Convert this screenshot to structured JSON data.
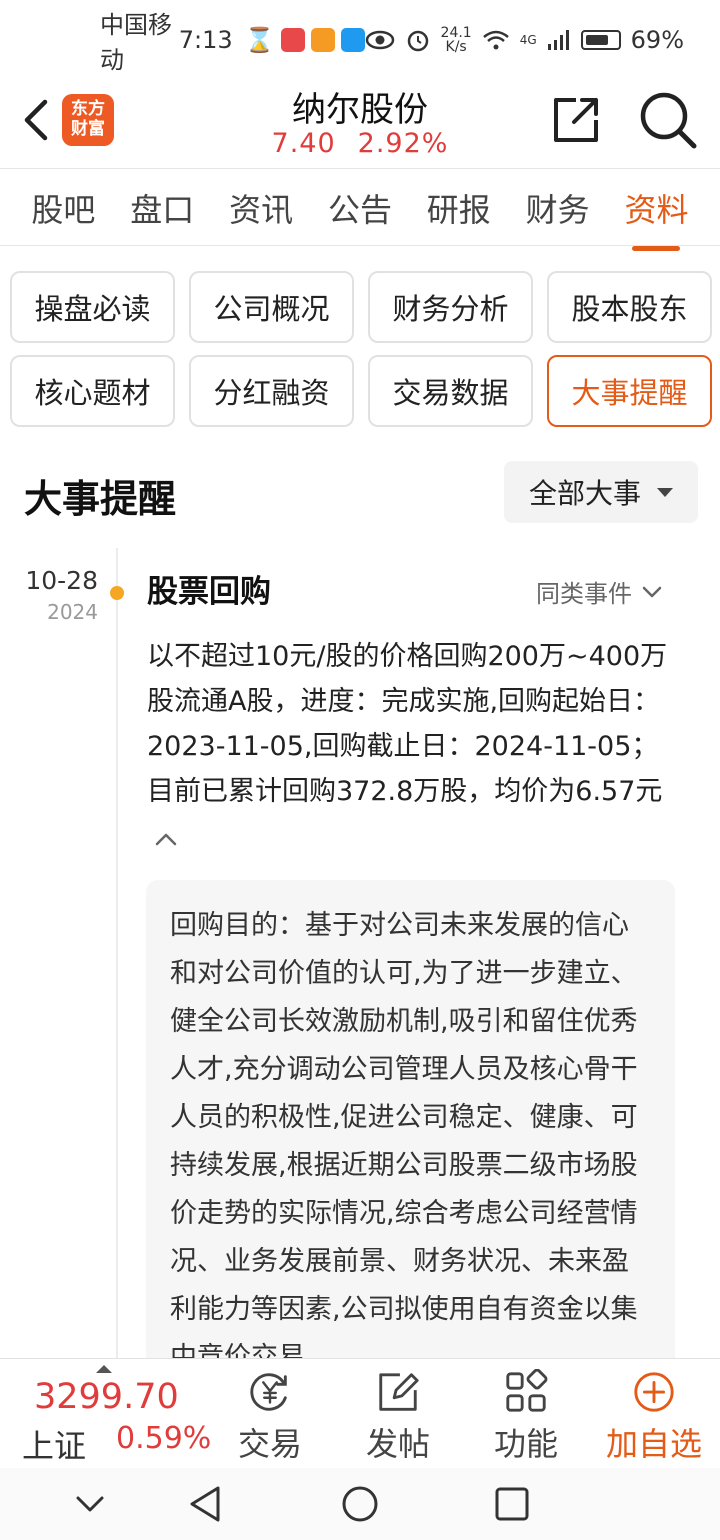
{
  "status": {
    "carrier": "中国移动",
    "time": "7:13",
    "net_speed_value": "24.1",
    "net_speed_unit": "K/s",
    "network": "4G",
    "battery": "69%"
  },
  "header": {
    "logo_line1": "东方",
    "logo_line2": "财富",
    "stock_name": "纳尔股份",
    "price": "7.40",
    "change_pct": "2.92%"
  },
  "tabs": [
    {
      "label": "股吧"
    },
    {
      "label": "盘口"
    },
    {
      "label": "资讯"
    },
    {
      "label": "公告"
    },
    {
      "label": "研报"
    },
    {
      "label": "财务"
    },
    {
      "label": "资料"
    }
  ],
  "grid_buttons": [
    {
      "label": "操盘必读"
    },
    {
      "label": "公司概况"
    },
    {
      "label": "财务分析"
    },
    {
      "label": "股本股东"
    },
    {
      "label": "核心题材"
    },
    {
      "label": "分红融资"
    },
    {
      "label": "交易数据"
    },
    {
      "label": "大事提醒"
    }
  ],
  "section": {
    "title": "大事提醒",
    "filter_label": "全部大事"
  },
  "event": {
    "date": "10-28",
    "year": "2024",
    "title": "股票回购",
    "similar_label": "同类事件",
    "description": "以不超过10元/股的价格回购200万~400万股流通A股，进度：完成实施,回购起始日：2023-11-05,回购截止日：2024-11-05；目前已累计回购372.8万股，均价为6.57元",
    "detail": "回购目的：基于对公司未来发展的信心和对公司价值的认可,为了进一步建立、健全公司长效激励机制,吸引和留住优秀人才,充分调动公司管理人员及核心骨干人员的积极性,促进公司稳定、健康、可持续发展,根据近期公司股票二级市场股价走势的实际情况,综合考虑公司经营情况、业务发展前景、财务状况、未来盈利能力等因素,公司拟使用自有资金以集中竞价交易"
  },
  "bottom_bar": {
    "index_value": "3299.70",
    "index_name": "上证",
    "index_change": "0.59%",
    "items": [
      {
        "label": "交易"
      },
      {
        "label": "发帖"
      },
      {
        "label": "功能"
      },
      {
        "label": "加自选"
      }
    ]
  },
  "colors": {
    "accent": "#e35b17",
    "up": "#e03c3c",
    "dot": "#f5a623"
  }
}
